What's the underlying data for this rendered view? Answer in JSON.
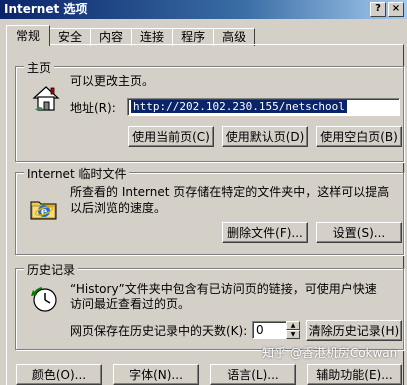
{
  "window": {
    "title": "Internet 选项"
  },
  "tabs": [
    {
      "label": "常规"
    },
    {
      "label": "安全"
    },
    {
      "label": "内容"
    },
    {
      "label": "连接"
    },
    {
      "label": "程序"
    },
    {
      "label": "高级"
    }
  ],
  "homepage": {
    "group_label": "主页",
    "description": "可以更改主页。",
    "address_label": "地址(R):",
    "address_value": "http://202.102.230.155/netschool",
    "btn_current": "使用当前页(C)",
    "btn_default": "使用默认页(D)",
    "btn_blank": "使用空白页(B)"
  },
  "temp_files": {
    "group_label": "Internet 临时文件",
    "description_line1": "所查看的 Internet 页存储在特定的文件夹中，这样可以提高",
    "description_line2": "以后浏览的速度。",
    "btn_delete": "删除文件(F)...",
    "btn_settings": "设置(S)..."
  },
  "history": {
    "group_label": "历史记录",
    "description_line1": "“History”文件夹中包含有已访问页的链接，可使用户快速",
    "description_line2": "访问最近查看过的页。",
    "days_label": "网页保存在历史记录中的天数(K):",
    "days_value": "0",
    "btn_clear": "清除历史记录(H)"
  },
  "bottom_buttons": [
    "颜色(O)...",
    "字体(N)...",
    "语言(L)...",
    "辅助功能(E)..."
  ],
  "watermark": "知乎 @香港机房Cokwan"
}
